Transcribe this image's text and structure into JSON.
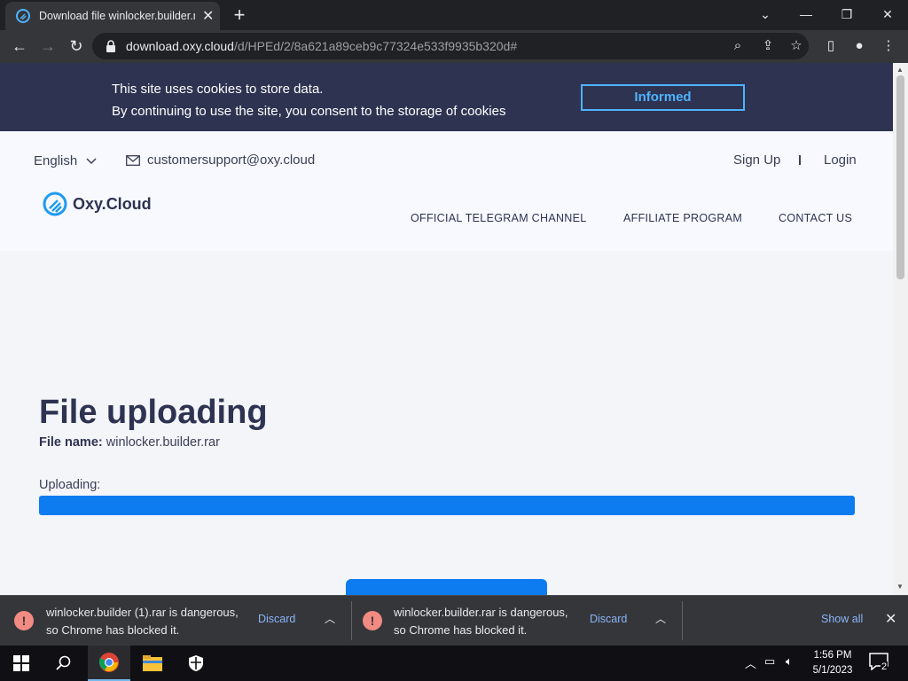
{
  "browser": {
    "tab_title": "Download file winlocker.builder.r",
    "new_tab_symbol": "+",
    "url_host": "download.oxy.cloud",
    "url_path": "/d/HPEd/2/8a621a89ceb9c77324e533f9935b320d#"
  },
  "cookie_banner": {
    "line1": "This site uses cookies to store data.",
    "line2": "By continuing to use the site, you consent to the storage of cookies",
    "button": "Informed"
  },
  "header": {
    "language": "English",
    "email": "customersupport@oxy.cloud",
    "sign_up": "Sign Up",
    "login": "Login",
    "logo_text": "Oxy.Cloud",
    "nav": [
      "OFFICIAL TELEGRAM CHANNEL",
      "AFFILIATE PROGRAM",
      "CONTACT US"
    ]
  },
  "main": {
    "title": "File uploading",
    "file_name_label": "File name:",
    "file_name": "winlocker.builder.rar",
    "uploading_label": "Uploading:",
    "progress_fraction": 1.0
  },
  "downloads": {
    "items": [
      {
        "line1": "winlocker.builder (1).rar is dangerous,",
        "line2": "so Chrome has blocked it.",
        "action": "Discard"
      },
      {
        "line1": "winlocker.builder.rar is dangerous,",
        "line2": "so Chrome has blocked it.",
        "action": "Discard"
      }
    ],
    "show_all": "Show all"
  },
  "taskbar": {
    "time": "1:56 PM",
    "date": "5/1/2023",
    "notification_count": "2"
  },
  "colors": {
    "cookie_bg": "#2d3351",
    "accent_blue": "#0d7cf0",
    "link_blue": "#8ab4f8",
    "warning_red": "#f28b82"
  },
  "icons": [
    "back-icon",
    "forward-icon",
    "reload-icon",
    "lock-icon",
    "search-icon",
    "share-icon",
    "star-icon",
    "sidepanel-icon",
    "profile-icon",
    "menu-icon",
    "mail-icon",
    "chevron-down-icon",
    "warning-icon",
    "windows-start-icon",
    "taskbar-search-icon",
    "chrome-icon",
    "file-explorer-icon",
    "security-icon"
  ]
}
